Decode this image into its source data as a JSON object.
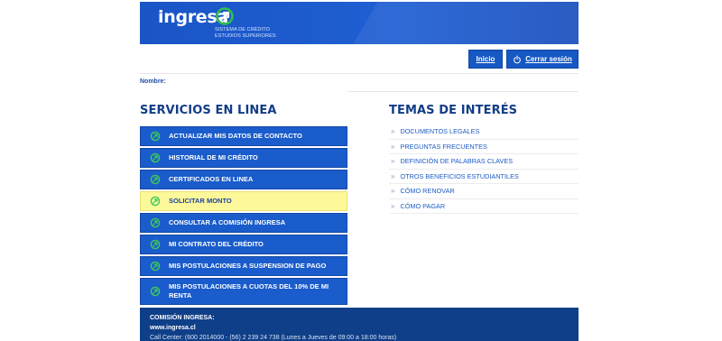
{
  "header": {
    "logo_text": "ingresa",
    "logo_sub_line1": "SISTEMA DE CRÉDITO",
    "logo_sub_line2": "ESTUDIOS SUPERIORES",
    "brand_color": "#1a55c6",
    "accent_color": "#2fc14a"
  },
  "nav": {
    "inicio_label": "Inicio",
    "logout_label": "Cerrar sesión",
    "logout_icon": "power-icon"
  },
  "user": {
    "nombre_label": "Nombre:"
  },
  "services": {
    "title": "SERVICIOS EN LINEA",
    "item_icon": "arrow-circle-icon",
    "items": [
      {
        "label": "ACTUALIZAR MIS DATOS DE CONTACTO",
        "highlighted": false
      },
      {
        "label": "HISTORIAL DE MI CRÉDITO",
        "highlighted": false
      },
      {
        "label": "CERTIFICADOS EN LINEA",
        "highlighted": false
      },
      {
        "label": "SOLICITAR MONTO",
        "highlighted": true
      },
      {
        "label": "CONSULTAR A COMISIÓN INGRESA",
        "highlighted": false
      },
      {
        "label": "MI CONTRATO DEL CRÉDITO",
        "highlighted": false
      },
      {
        "label": "MIS POSTULACIONES A SUSPENSION DE PAGO",
        "highlighted": false
      },
      {
        "label": "MIS POSTULACIONES A CUOTAS DEL 10% DE MI RENTA",
        "highlighted": false
      }
    ]
  },
  "temas": {
    "title": "TEMAS DE INTERÉS",
    "bullet": "»",
    "items": [
      "DOCUMENTOS LEGALES",
      "PREGUNTAS FRECUENTES",
      "DEFINICIÓN DE PALABRAS CLAVES",
      "OTROS BENEFICIOS ESTUDIANTILES",
      "CÓMO RENOVAR",
      "CÓMO PAGAR"
    ]
  },
  "footer": {
    "org_label": "COMISIÓN INGRESA:",
    "website": "www.ingresa.cl",
    "callcenter": "Call Center: (600 2014000 - (56) 2 239 24 738 (Lunes a Jueves de 09:00 a 18:00 horas)"
  }
}
